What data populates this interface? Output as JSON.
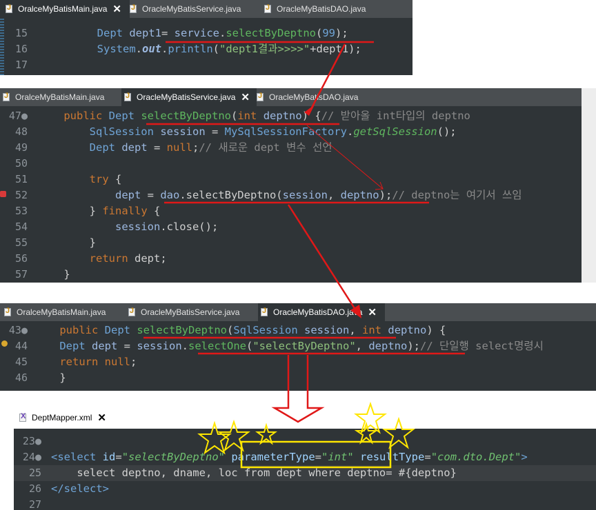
{
  "panel1": {
    "tabs": [
      "OralceMyBatisMain.java",
      "OracleMyBatisService.java",
      "OracleMyBatisDAO.java"
    ],
    "lines": [
      {
        "n": "15",
        "parts": [
          [
            "",
            "        "
          ],
          [
            "ty",
            "Dept"
          ],
          [
            "",
            " "
          ],
          [
            "fld",
            "dept1"
          ],
          [
            "",
            "= "
          ],
          [
            "fld",
            "service"
          ],
          [
            "",
            "."
          ],
          [
            "mt",
            "selectByDeptno"
          ],
          [
            "",
            "("
          ],
          [
            "num",
            "99"
          ],
          [
            "",
            ");"
          ]
        ]
      },
      {
        "n": "16",
        "parts": [
          [
            "",
            "        "
          ],
          [
            "ty",
            "System"
          ],
          [
            "",
            "."
          ],
          [
            "fld it bld",
            "out"
          ],
          [
            "",
            "."
          ],
          [
            "ty",
            "println"
          ],
          [
            "",
            "("
          ],
          [
            "str",
            "\"dept1결과>>>>\""
          ],
          [
            "",
            "+dept1);"
          ]
        ]
      },
      {
        "n": "17",
        "parts": []
      }
    ]
  },
  "panel2": {
    "tabs": [
      "OralceMyBatisMain.java",
      "OracleMyBatisService.java",
      "OracleMyBatisDAO.java"
    ],
    "lines": [
      {
        "n": "47●",
        "parts": [
          [
            "",
            "    "
          ],
          [
            "kw",
            "public"
          ],
          [
            "",
            " "
          ],
          [
            "ty",
            "Dept"
          ],
          [
            "",
            " "
          ],
          [
            "mt",
            "selectByDeptno"
          ],
          [
            "",
            "("
          ],
          [
            "kw",
            "int"
          ],
          [
            "",
            " "
          ],
          [
            "fld",
            "deptno"
          ],
          [
            "",
            ") {"
          ],
          [
            "cm",
            "// 받아올 int타입의 deptno"
          ]
        ]
      },
      {
        "n": "48",
        "parts": [
          [
            "",
            "        "
          ],
          [
            "ty",
            "SqlSession"
          ],
          [
            "",
            " "
          ],
          [
            "fld",
            "session"
          ],
          [
            "",
            " = "
          ],
          [
            "ty",
            "MySqlSessionFactory"
          ],
          [
            "",
            "."
          ],
          [
            "mt it",
            "getSqlSession"
          ],
          [
            "",
            "();"
          ]
        ]
      },
      {
        "n": "49",
        "parts": [
          [
            "",
            "        "
          ],
          [
            "ty",
            "Dept"
          ],
          [
            "",
            " "
          ],
          [
            "fld",
            "dept"
          ],
          [
            "",
            " = "
          ],
          [
            "kw",
            "null"
          ],
          [
            "",
            ";"
          ],
          [
            "cm",
            "// 새로운 dept 변수 선언"
          ]
        ]
      },
      {
        "n": "50",
        "parts": []
      },
      {
        "n": "51",
        "parts": [
          [
            "",
            "        "
          ],
          [
            "kw",
            "try"
          ],
          [
            "",
            " {"
          ]
        ]
      },
      {
        "n": "52",
        "parts": [
          [
            "",
            "            "
          ],
          [
            "fld",
            "dept"
          ],
          [
            "",
            " = "
          ],
          [
            "fld",
            "dao"
          ],
          [
            "",
            ".selectByDeptno("
          ],
          [
            "fld",
            "session"
          ],
          [
            "",
            ", "
          ],
          [
            "fld",
            "deptno"
          ],
          [
            "",
            ");"
          ],
          [
            "cm",
            "// deptno는 여기서 쓰임"
          ]
        ]
      },
      {
        "n": "53",
        "parts": [
          [
            "",
            "        } "
          ],
          [
            "kw",
            "finally"
          ],
          [
            "",
            " {"
          ]
        ]
      },
      {
        "n": "54",
        "parts": [
          [
            "",
            "            "
          ],
          [
            "fld",
            "session"
          ],
          [
            "",
            ".close();"
          ]
        ]
      },
      {
        "n": "55",
        "parts": [
          [
            "",
            "        }"
          ]
        ]
      },
      {
        "n": "56",
        "parts": [
          [
            "",
            "        "
          ],
          [
            "kw",
            "return"
          ],
          [
            "",
            " dept;"
          ]
        ]
      },
      {
        "n": "57",
        "parts": [
          [
            "",
            "    }"
          ]
        ]
      }
    ]
  },
  "panel3": {
    "tabs": [
      "OralceMyBatisMain.java",
      "OracleMyBatisService.java",
      "OracleMyBatisDAO.java"
    ],
    "lines": [
      {
        "n": "43●",
        "parts": [
          [
            "",
            "    "
          ],
          [
            "kw",
            "public"
          ],
          [
            "",
            " "
          ],
          [
            "ty",
            "Dept"
          ],
          [
            "",
            " "
          ],
          [
            "mt",
            "selectByDeptno"
          ],
          [
            "",
            "("
          ],
          [
            "ty",
            "SqlSession"
          ],
          [
            "",
            " "
          ],
          [
            "fld",
            "session"
          ],
          [
            "",
            ", "
          ],
          [
            "kw",
            "int"
          ],
          [
            "",
            " "
          ],
          [
            "fld",
            "deptno"
          ],
          [
            "",
            ") {"
          ]
        ]
      },
      {
        "n": "44",
        "parts": [
          [
            "",
            "    "
          ],
          [
            "ty",
            "Dept"
          ],
          [
            "",
            " "
          ],
          [
            "fld",
            "dept"
          ],
          [
            "",
            " = "
          ],
          [
            "fld",
            "session"
          ],
          [
            "",
            "."
          ],
          [
            "mt",
            "selectOne"
          ],
          [
            "",
            "("
          ],
          [
            "str",
            "\"selectByDeptno\""
          ],
          [
            "",
            ", "
          ],
          [
            "fld",
            "deptno"
          ],
          [
            "",
            ");"
          ],
          [
            "cm",
            "// 단일행 select명령시"
          ]
        ]
      },
      {
        "n": "45",
        "parts": [
          [
            "",
            "    "
          ],
          [
            "kw",
            "return"
          ],
          [
            "",
            " "
          ],
          [
            "kw",
            "null"
          ],
          [
            "",
            ";"
          ]
        ]
      },
      {
        "n": "46",
        "parts": [
          [
            "",
            "    }"
          ]
        ]
      }
    ]
  },
  "panel4": {
    "tab": "DeptMapper.xml",
    "lines": [
      {
        "n": "23●",
        "parts": []
      },
      {
        "n": "24●",
        "parts": [
          [
            "xml-tag",
            "<select"
          ],
          [
            "",
            " "
          ],
          [
            "xml-attr",
            "id"
          ],
          [
            "",
            "="
          ],
          [
            "xml-val",
            "\"selectByDeptno\""
          ],
          [
            "",
            " "
          ],
          [
            "xml-attr",
            "parameterType"
          ],
          [
            "",
            "="
          ],
          [
            "xml-val",
            "\"int\""
          ],
          [
            "",
            " "
          ],
          [
            "xml-attr",
            "resultType"
          ],
          [
            "",
            "="
          ],
          [
            "xml-val",
            "\"com.dto.Dept\""
          ],
          [
            "xml-tag",
            ">"
          ]
        ]
      },
      {
        "n": "25",
        "parts": [
          [
            "",
            "    select deptno, dname, loc from dept where deptno= #{deptno}"
          ]
        ]
      },
      {
        "n": "26",
        "parts": [
          [
            "xml-tag",
            "</select"
          ],
          [
            "xml-tag",
            ">"
          ]
        ]
      },
      {
        "n": "27",
        "parts": []
      }
    ]
  },
  "colors": {
    "annotation": "#e01818",
    "highlight": "#ffe600"
  }
}
